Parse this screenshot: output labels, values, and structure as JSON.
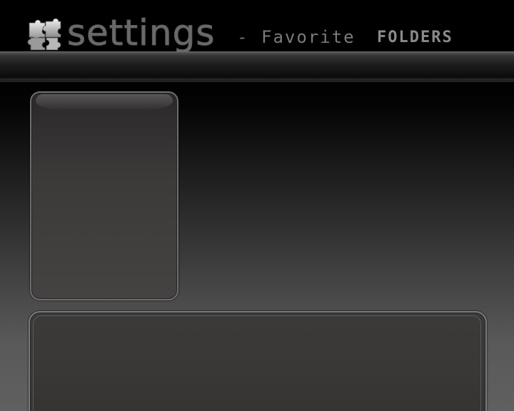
{
  "header": {
    "title": "settings",
    "separator": "-",
    "subtitle": "Favorite",
    "subtitle_accent": "FOLDERS",
    "logo_icon": "puzzle-pieces-icon"
  },
  "colors": {
    "background_top": "#000000",
    "background_bottom": "#606060",
    "panel_fill": "#3c3a39",
    "panel_border": "#6e6e6e",
    "title_text": "#6a6a6a"
  }
}
